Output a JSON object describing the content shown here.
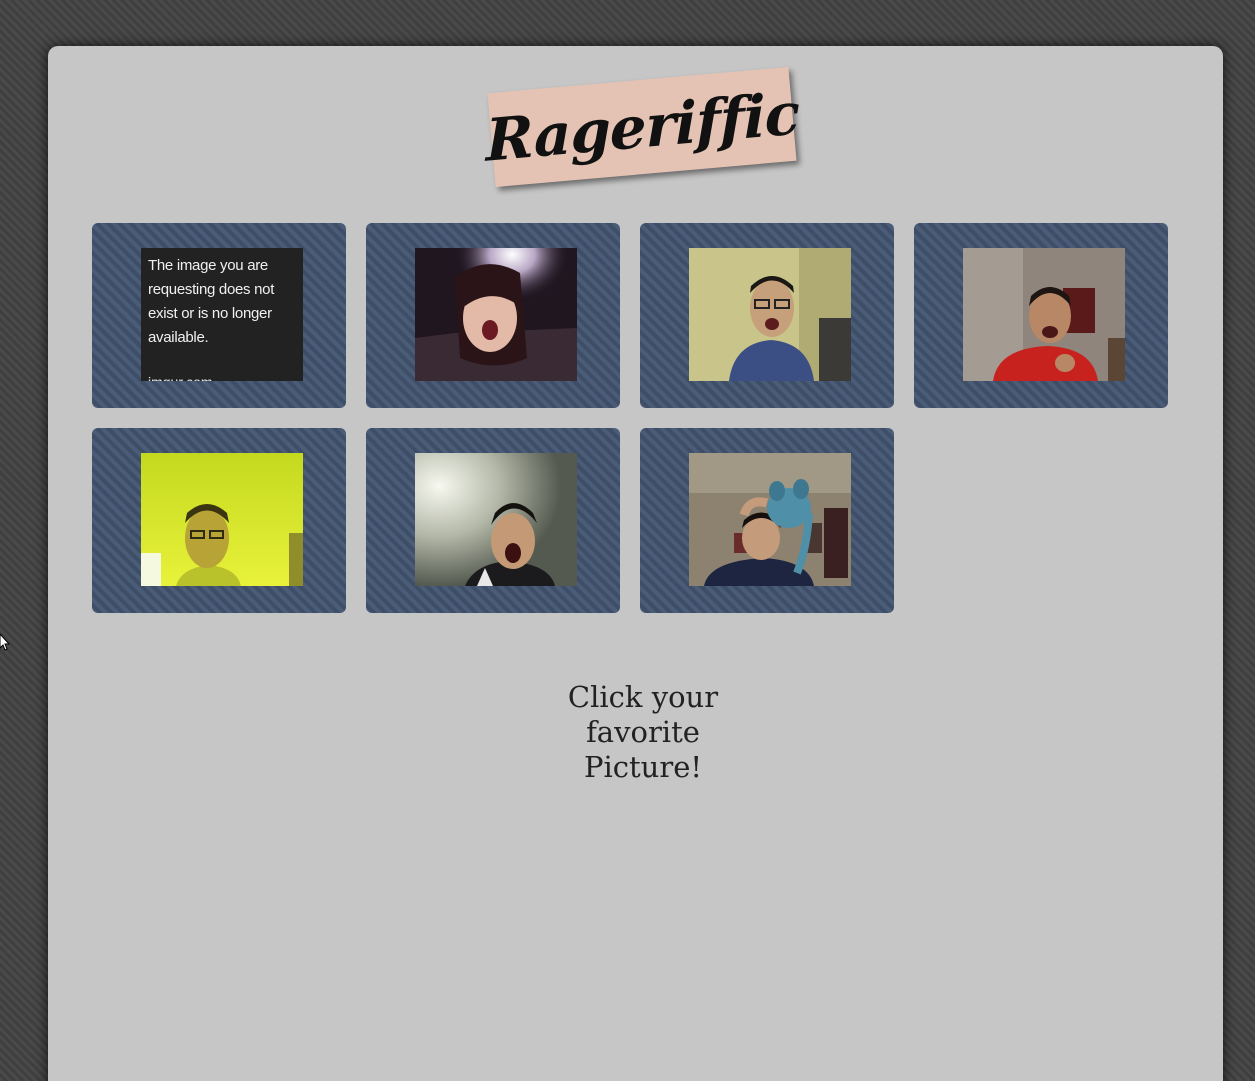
{
  "app": {
    "title": "Rageriffic"
  },
  "gallery": {
    "tiles": [
      {
        "kind": "missing",
        "message": "The image you are requesting does not exist or is no longer available.",
        "site": "imgur.com"
      },
      {
        "kind": "photo",
        "label": "girl-screaming"
      },
      {
        "kind": "photo",
        "label": "man-glasses-shouting"
      },
      {
        "kind": "photo",
        "label": "man-red-shirt-laughing"
      },
      {
        "kind": "photo",
        "label": "man-yellow-tint"
      },
      {
        "kind": "photo",
        "label": "man-yawning"
      },
      {
        "kind": "photo",
        "label": "man-with-plush-toy"
      }
    ]
  },
  "prompt": {
    "line1": "Click your",
    "line2": "favorite",
    "line3": "Picture!"
  },
  "colors": {
    "page_background": "#444444",
    "card_background": "#c6c6c6",
    "tile_background": "#44556f",
    "logo_background": "#e5c3b4"
  }
}
